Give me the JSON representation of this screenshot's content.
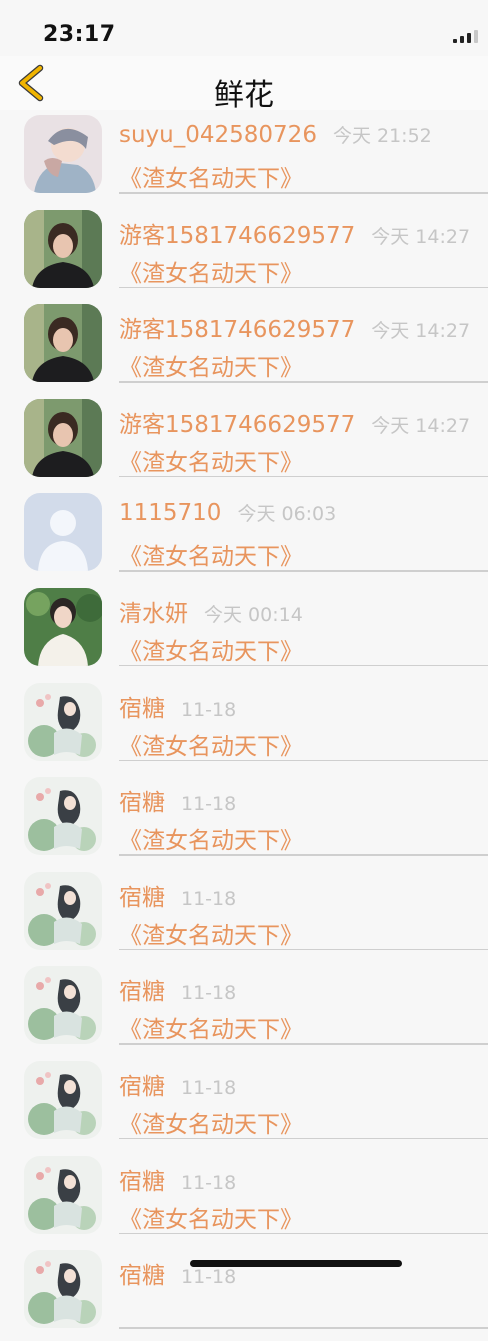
{
  "status_bar": {
    "time": "23:17"
  },
  "nav": {
    "title": "鲜花",
    "back_icon": "chevron-left-icon",
    "accent": "#f0b400"
  },
  "colors": {
    "name": "#e8955e",
    "date": "#c6c6c6",
    "background": "#f7f7f7"
  },
  "items": [
    {
      "name": "suyu_042580726",
      "date": "今天 21:52",
      "work": "《渣女名动天下》",
      "avatar": "anime"
    },
    {
      "name": "游客1581746629577",
      "date": "今天 14:27",
      "work": "《渣女名动天下》",
      "avatar": "girl"
    },
    {
      "name": "游客1581746629577",
      "date": "今天 14:27",
      "work": "《渣女名动天下》",
      "avatar": "girl"
    },
    {
      "name": "游客1581746629577",
      "date": "今天 14:27",
      "work": "《渣女名动天下》",
      "avatar": "girl"
    },
    {
      "name": "1115710",
      "date": "今天 06:03",
      "work": "《渣女名动天下》",
      "avatar": "default"
    },
    {
      "name": "清水妍",
      "date": "今天 00:14",
      "work": "《渣女名动天下》",
      "avatar": "boy"
    },
    {
      "name": "宿糖",
      "date": "11-18",
      "work": "《渣女名动天下》",
      "avatar": "painting"
    },
    {
      "name": "宿糖",
      "date": "11-18",
      "work": "《渣女名动天下》",
      "avatar": "painting"
    },
    {
      "name": "宿糖",
      "date": "11-18",
      "work": "《渣女名动天下》",
      "avatar": "painting"
    },
    {
      "name": "宿糖",
      "date": "11-18",
      "work": "《渣女名动天下》",
      "avatar": "painting"
    },
    {
      "name": "宿糖",
      "date": "11-18",
      "work": "《渣女名动天下》",
      "avatar": "painting"
    },
    {
      "name": "宿糖",
      "date": "11-18",
      "work": "《渣女名动天下》",
      "avatar": "painting"
    },
    {
      "name": "宿糖",
      "date": "11-18",
      "work": "",
      "avatar": "painting"
    }
  ]
}
